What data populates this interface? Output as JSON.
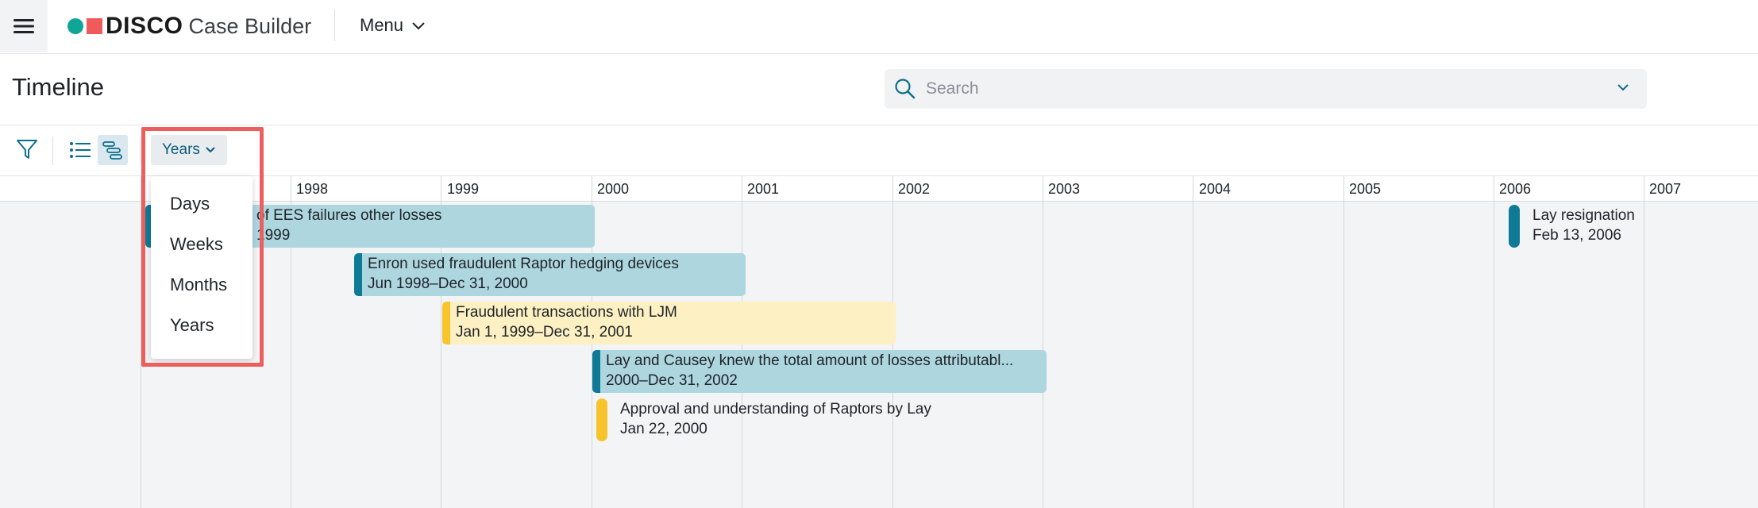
{
  "app": {
    "brand": "DISCO",
    "product": "Case Builder",
    "menu_label": "Menu"
  },
  "page": {
    "title": "Timeline"
  },
  "search": {
    "placeholder": "Search"
  },
  "toolbar": {
    "scale_label": "Years"
  },
  "scale_menu": {
    "options": [
      "Days",
      "Weeks",
      "Months",
      "Years"
    ]
  },
  "axis": {
    "years": [
      "1998",
      "1999",
      "2000",
      "2001",
      "2002",
      "2003",
      "2004",
      "2005",
      "2006",
      "2007"
    ]
  },
  "events": [
    {
      "title": "of EES failures other losses",
      "date": "1999",
      "color": "blue"
    },
    {
      "title": "Enron used fraudulent Raptor hedging devices",
      "date": "Jun 1998–Dec 31, 2000",
      "color": "blue"
    },
    {
      "title": "Fraudulent transactions with LJM",
      "date": "Jan 1, 1999–Dec 31, 2001",
      "color": "yellow"
    },
    {
      "title": "Lay and Causey knew the total amount of losses attributabl...",
      "date": "2000–Dec 31, 2002",
      "color": "blue"
    },
    {
      "title": "Approval and understanding of Raptors by Lay",
      "date": "Jan 22, 2000",
      "color": "yellow"
    },
    {
      "title": "Lay resignation",
      "date": "Feb 13, 2006",
      "color": "blue"
    }
  ],
  "colors": {
    "accent_blue": "#0f7a96",
    "bar_blue": "#add6df",
    "accent_yellow": "#f8c42c",
    "bar_yellow": "#fdf0c2",
    "highlight": "#ec5f5f",
    "logo_teal": "#0fa698",
    "logo_red": "#ef5b5b"
  },
  "icons": [
    "hamburger-icon",
    "search-icon",
    "chevron-down-icon",
    "filter-icon",
    "list-view-icon",
    "timeline-view-icon"
  ]
}
